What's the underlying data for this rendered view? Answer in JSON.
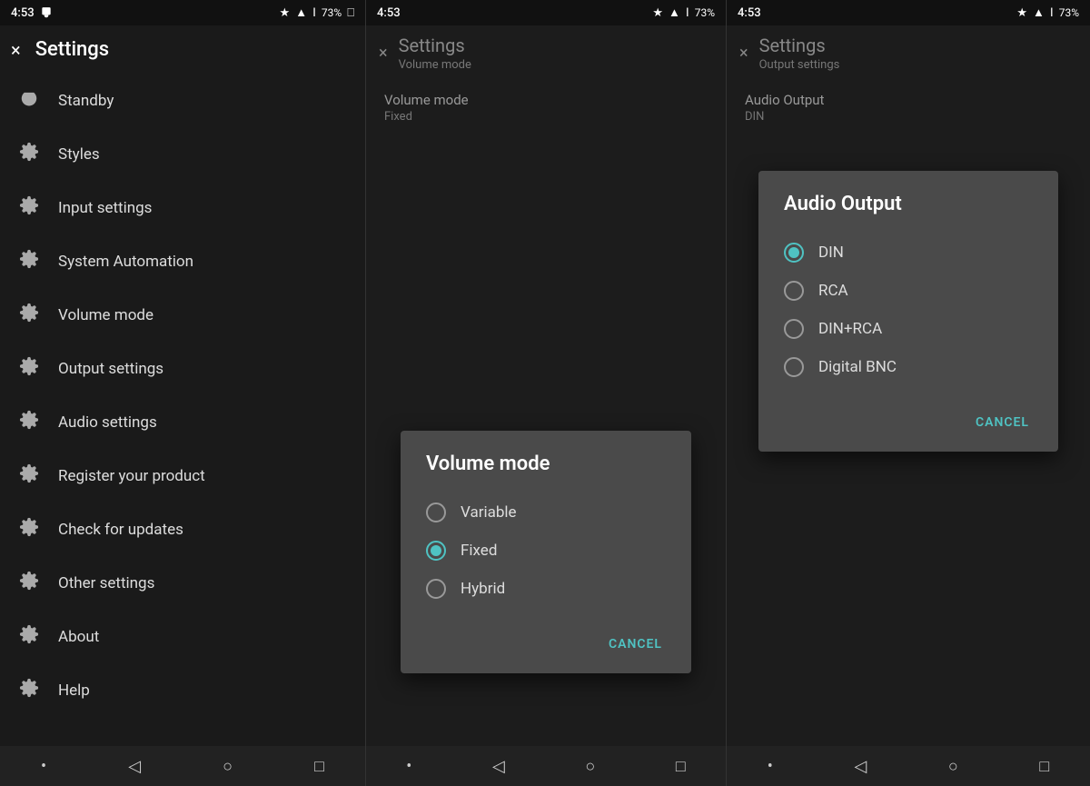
{
  "statusBar": {
    "time": "4:53",
    "battery": "73%"
  },
  "panel1": {
    "title": "Settings",
    "closeIcon": "×",
    "items": [
      {
        "id": "standby",
        "label": "Standby",
        "icon": "power"
      },
      {
        "id": "styles",
        "label": "Styles",
        "icon": "gear"
      },
      {
        "id": "input-settings",
        "label": "Input settings",
        "icon": "gear"
      },
      {
        "id": "system-automation",
        "label": "System Automation",
        "icon": "gear"
      },
      {
        "id": "volume-mode",
        "label": "Volume mode",
        "icon": "gear"
      },
      {
        "id": "output-settings",
        "label": "Output settings",
        "icon": "gear"
      },
      {
        "id": "audio-settings",
        "label": "Audio settings",
        "icon": "gear"
      },
      {
        "id": "register-product",
        "label": "Register your product",
        "icon": "gear"
      },
      {
        "id": "check-updates",
        "label": "Check for updates",
        "icon": "gear"
      },
      {
        "id": "other-settings",
        "label": "Other settings",
        "icon": "gear"
      },
      {
        "id": "about",
        "label": "About",
        "icon": "gear"
      },
      {
        "id": "help",
        "label": "Help",
        "icon": "gear"
      }
    ],
    "navBar": {
      "dot": "•",
      "back": "◁",
      "home": "○",
      "square": "□"
    }
  },
  "panel2": {
    "title": "Settings",
    "subtitle": "Volume mode",
    "settingName": "Volume mode",
    "settingValue": "Fixed",
    "closeIcon": "×",
    "dialog": {
      "title": "Volume mode",
      "options": [
        {
          "id": "variable",
          "label": "Variable",
          "selected": false
        },
        {
          "id": "fixed",
          "label": "Fixed",
          "selected": true
        },
        {
          "id": "hybrid",
          "label": "Hybrid",
          "selected": false
        }
      ],
      "cancelLabel": "CANCEL"
    },
    "navBar": {
      "dot": "•",
      "back": "◁",
      "home": "○",
      "square": "□"
    }
  },
  "panel3": {
    "title": "Settings",
    "subtitle": "Output settings",
    "settingName": "Audio Output",
    "settingValue": "DIN",
    "closeIcon": "×",
    "dialog": {
      "title": "Audio Output",
      "options": [
        {
          "id": "din",
          "label": "DIN",
          "selected": true
        },
        {
          "id": "rca",
          "label": "RCA",
          "selected": false
        },
        {
          "id": "din-rca",
          "label": "DIN+RCA",
          "selected": false
        },
        {
          "id": "digital-bnc",
          "label": "Digital BNC",
          "selected": false
        }
      ],
      "cancelLabel": "CANCEL"
    },
    "navBar": {
      "dot": "•",
      "back": "◁",
      "home": "○",
      "square": "□"
    }
  },
  "colors": {
    "accent": "#4fc3c3",
    "panelBg": "#1a1a1a",
    "dialogBg": "#4a4a4a",
    "textPrimary": "#ffffff",
    "textSecondary": "#999999"
  }
}
